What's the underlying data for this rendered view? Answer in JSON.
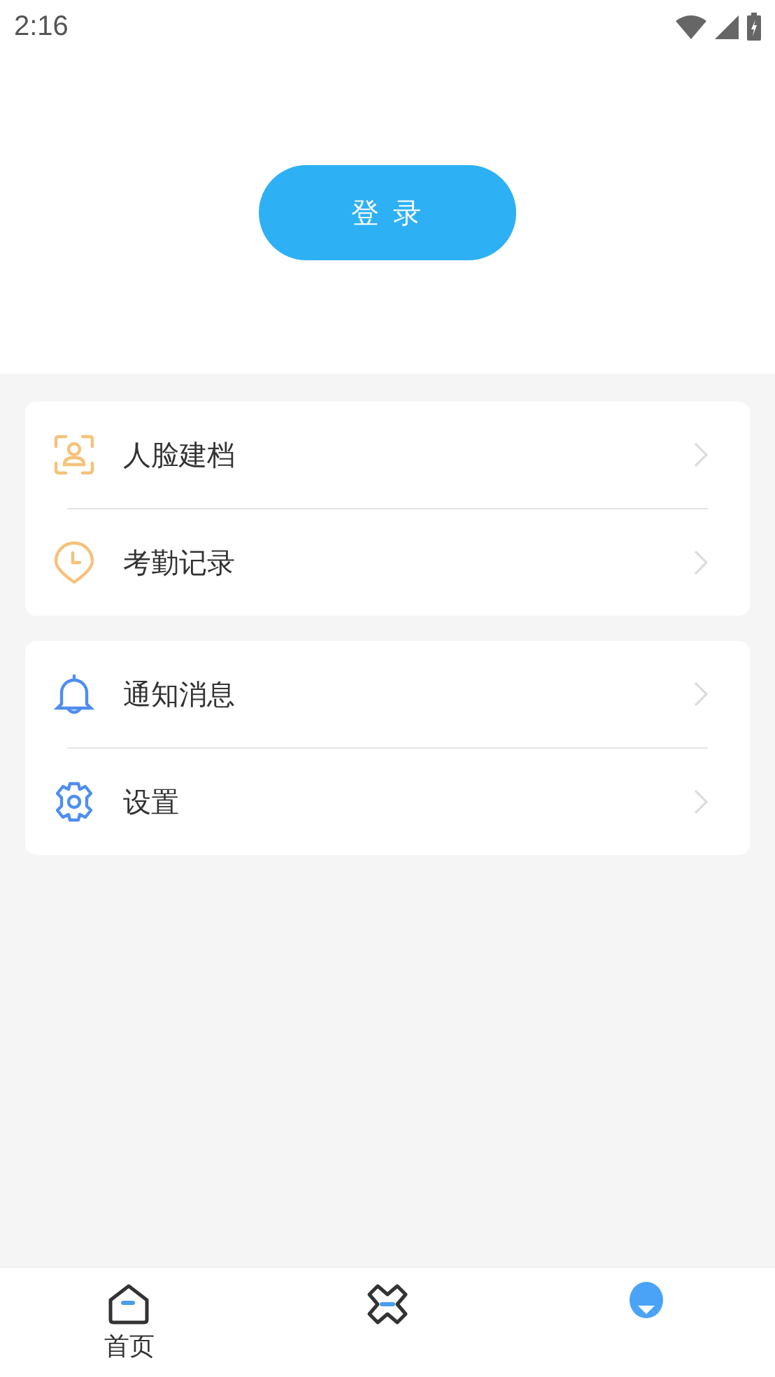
{
  "status_bar": {
    "time": "2:16"
  },
  "login_button": {
    "label": "登 录"
  },
  "menu_groups": [
    {
      "items": [
        {
          "label": "人脸建档",
          "kind": "face"
        },
        {
          "label": "考勤记录",
          "kind": "clock"
        }
      ]
    },
    {
      "items": [
        {
          "label": "通知消息",
          "kind": "bell"
        },
        {
          "label": "设置",
          "kind": "gear"
        }
      ]
    }
  ],
  "bottom_nav": [
    {
      "kind": "home",
      "label": "首页",
      "selected": false
    },
    {
      "kind": "apps",
      "selected": false
    },
    {
      "kind": "profile",
      "selected": true
    }
  ]
}
